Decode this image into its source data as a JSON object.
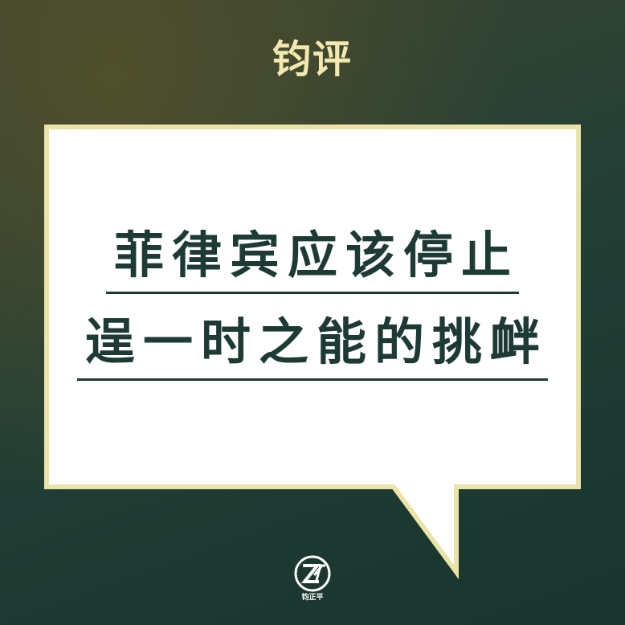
{
  "header": {
    "title": "钧评"
  },
  "bubble": {
    "line1": "菲律宾应该停止",
    "line2": "逞一时之能的挑衅"
  },
  "logo": {
    "text": "钧正平"
  },
  "colors": {
    "background": "#1f3d35",
    "title": "#f3e8b0",
    "bubble_fill": "#ffffff",
    "bubble_border": "#ece3a9",
    "headline_text": "#1d3a35"
  }
}
